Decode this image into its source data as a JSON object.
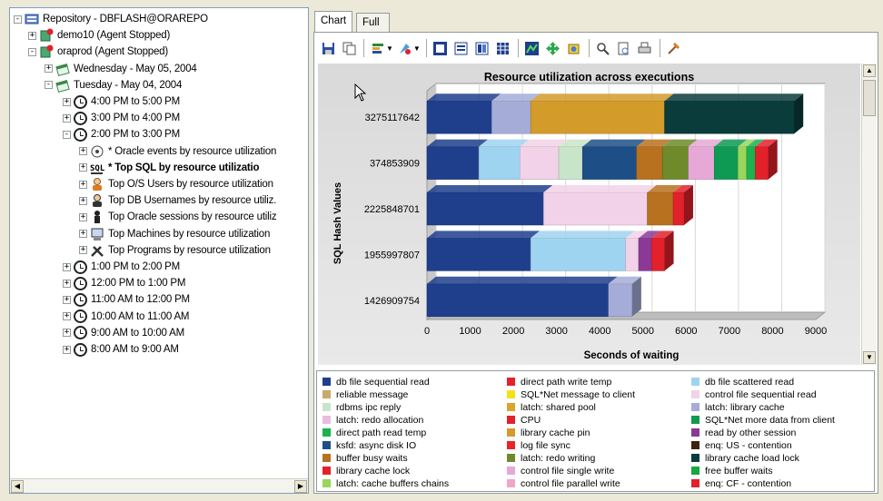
{
  "tree": {
    "nodes": [
      {
        "label": "Repository - DBFLASH@ORAREPO",
        "depth": 0,
        "toggle": "-",
        "icon": "repository-icon"
      },
      {
        "label": "demo10 (Agent Stopped)",
        "depth": 1,
        "toggle": "+",
        "icon": "agent-stopped-icon"
      },
      {
        "label": "oraprod (Agent Stopped)",
        "depth": 1,
        "toggle": "-",
        "icon": "agent-stopped-icon"
      },
      {
        "label": "Wednesday - May 05, 2004",
        "depth": 2,
        "toggle": "+",
        "icon": "calendar-icon"
      },
      {
        "label": "Tuesday - May 04, 2004",
        "depth": 2,
        "toggle": "-",
        "icon": "calendar-icon"
      },
      {
        "label": "4:00 PM to 5:00 PM",
        "depth": 3,
        "toggle": "+",
        "icon": "clock-icon"
      },
      {
        "label": "3:00 PM to 4:00 PM",
        "depth": 3,
        "toggle": "+",
        "icon": "clock-icon"
      },
      {
        "label": "2:00 PM to 3:00 PM",
        "depth": 3,
        "toggle": "-",
        "icon": "clock-icon"
      },
      {
        "label": "* Oracle events by resource utilization",
        "depth": 4,
        "toggle": "+",
        "icon": "events-icon"
      },
      {
        "label": "* Top SQL by resource utilizatio",
        "depth": 4,
        "toggle": "+",
        "icon": "sql-icon",
        "bold": true
      },
      {
        "label": "Top O/S Users by resource utilization",
        "depth": 4,
        "toggle": "+",
        "icon": "os-user-icon"
      },
      {
        "label": "Top DB Usernames by resource utiliz.",
        "depth": 4,
        "toggle": "+",
        "icon": "db-user-icon"
      },
      {
        "label": "Top Oracle sessions by resource utiliz",
        "depth": 4,
        "toggle": "+",
        "icon": "session-icon"
      },
      {
        "label": "Top Machines by resource utilization",
        "depth": 4,
        "toggle": "+",
        "icon": "machine-icon"
      },
      {
        "label": "Top Programs by resource utilization",
        "depth": 4,
        "toggle": "+",
        "icon": "program-icon"
      },
      {
        "label": "1:00 PM to 2:00 PM",
        "depth": 3,
        "toggle": "+",
        "icon": "clock-icon"
      },
      {
        "label": "12:00 PM to 1:00 PM",
        "depth": 3,
        "toggle": "+",
        "icon": "clock-icon"
      },
      {
        "label": "11:00 AM to 12:00 PM",
        "depth": 3,
        "toggle": "+",
        "icon": "clock-icon"
      },
      {
        "label": "10:00 AM to 11:00 AM",
        "depth": 3,
        "toggle": "+",
        "icon": "clock-icon"
      },
      {
        "label": "9:00 AM to 10:00 AM",
        "depth": 3,
        "toggle": "+",
        "icon": "clock-icon"
      },
      {
        "label": "8:00 AM to 9:00 AM",
        "depth": 3,
        "toggle": "+",
        "icon": "clock-icon"
      }
    ]
  },
  "tabs": [
    {
      "label": "Chart",
      "active": true
    },
    {
      "label": "Full SQL Text",
      "active": false
    }
  ],
  "toolbar": {
    "icons": [
      "save-icon",
      "copy-icon",
      "chart-type-icon",
      "palette-icon",
      "data-grid-icon",
      "legend-icon",
      "series-icon",
      "table-icon",
      "3d-icon",
      "move-icon",
      "rotate-icon",
      "zoom-icon",
      "page-icon",
      "print-icon",
      "properties-icon"
    ]
  },
  "chart_data": {
    "type": "bar",
    "orientation": "horizontal",
    "stacked": true,
    "three_d": true,
    "title": "Resource utilization across executions",
    "xlabel": "Seconds of waiting",
    "ylabel": "SQL Hash Values",
    "xlim": [
      0,
      9000
    ],
    "xticks": [
      "0",
      "1000",
      "2000",
      "3000",
      "4000",
      "5000",
      "6000",
      "7000",
      "8000",
      "9000"
    ],
    "categories": [
      "3275117642",
      "374853909",
      "2225848701",
      "1955997807",
      "1426909754"
    ],
    "bars": [
      {
        "category": "3275117642",
        "segments": [
          {
            "series": "db file sequential read",
            "value": 1500
          },
          {
            "series": "latch: library cache",
            "value": 900
          },
          {
            "series": "library cache pin",
            "value": 3100
          },
          {
            "series": "library cache load lock",
            "value": 3000
          }
        ]
      },
      {
        "category": "374853909",
        "segments": [
          {
            "series": "db file sequential read",
            "value": 1200
          },
          {
            "series": "db file scattered read",
            "value": 950
          },
          {
            "series": "control file sequential read",
            "value": 900
          },
          {
            "series": "rdbms ipc reply",
            "value": 550
          },
          {
            "series": "ksfd: async disk IO",
            "value": 1250
          },
          {
            "series": "buffer busy waits",
            "value": 600
          },
          {
            "series": "latch: redo writing",
            "value": 600
          },
          {
            "series": "control file single write",
            "value": 600
          },
          {
            "series": "SQL*Net more data from client",
            "value": 550
          },
          {
            "series": "latch: cache buffers chains",
            "value": 200
          },
          {
            "series": "direct path read temp",
            "value": 200
          },
          {
            "series": "library cache lock",
            "value": 300
          }
        ]
      },
      {
        "category": "2225848701",
        "segments": [
          {
            "series": "db file sequential read",
            "value": 2700
          },
          {
            "series": "control file sequential read",
            "value": 2400
          },
          {
            "series": "buffer busy waits",
            "value": 600
          },
          {
            "series": "direct path write temp",
            "value": 250
          }
        ]
      },
      {
        "category": "1955997807",
        "segments": [
          {
            "series": "db file sequential read",
            "value": 2400
          },
          {
            "series": "db file scattered read",
            "value": 2200
          },
          {
            "series": "control file sequential read",
            "value": 300
          },
          {
            "series": "read by other session",
            "value": 300
          },
          {
            "series": "direct path write temp",
            "value": 300
          }
        ]
      },
      {
        "category": "1426909754",
        "segments": [
          {
            "series": "db file sequential read",
            "value": 4200
          },
          {
            "series": "latch: library cache",
            "value": 550
          }
        ]
      }
    ],
    "legend_position": "bottom",
    "legend": [
      {
        "name": "db file sequential read",
        "color": "#1f3e8c"
      },
      {
        "name": "reliable message",
        "color": "#c8a96a"
      },
      {
        "name": "rdbms ipc reply",
        "color": "#c9e5c9"
      },
      {
        "name": "latch: redo allocation",
        "color": "#e8bde0"
      },
      {
        "name": "direct path read temp",
        "color": "#1bb24f"
      },
      {
        "name": "ksfd: async disk IO",
        "color": "#1d4f86"
      },
      {
        "name": "buffer busy waits",
        "color": "#b8711f"
      },
      {
        "name": "library cache lock",
        "color": "#e3212b"
      },
      {
        "name": "latch: cache buffers chains",
        "color": "#9ad65a"
      },
      {
        "name": "direct path write temp",
        "color": "#e3212b"
      },
      {
        "name": "SQL*Net message to client",
        "color": "#f2e21a"
      },
      {
        "name": "latch: shared pool",
        "color": "#d9a52a"
      },
      {
        "name": "CPU",
        "color": "#e3212b"
      },
      {
        "name": "library cache pin",
        "color": "#d29b2a"
      },
      {
        "name": "log file sync",
        "color": "#ee2229"
      },
      {
        "name": "latch: redo writing",
        "color": "#6e8a2a"
      },
      {
        "name": "control file single write",
        "color": "#e6a8d6"
      },
      {
        "name": "control file parallel write",
        "color": "#f0a6c8"
      },
      {
        "name": "db file scattered read",
        "color": "#9fd4f0"
      },
      {
        "name": "control file sequential read",
        "color": "#f2d2e8"
      },
      {
        "name": "latch: library cache",
        "color": "#a5acd8"
      },
      {
        "name": "SQL*Net more data from client",
        "color": "#0e9a52"
      },
      {
        "name": "read by other session",
        "color": "#8a3a96"
      },
      {
        "name": "enq: US - contention",
        "color": "#3a2410"
      },
      {
        "name": "library cache load lock",
        "color": "#0a3c3c"
      },
      {
        "name": "free buffer waits",
        "color": "#15a83a"
      },
      {
        "name": "enq: CF - contention",
        "color": "#e3212b"
      }
    ]
  }
}
